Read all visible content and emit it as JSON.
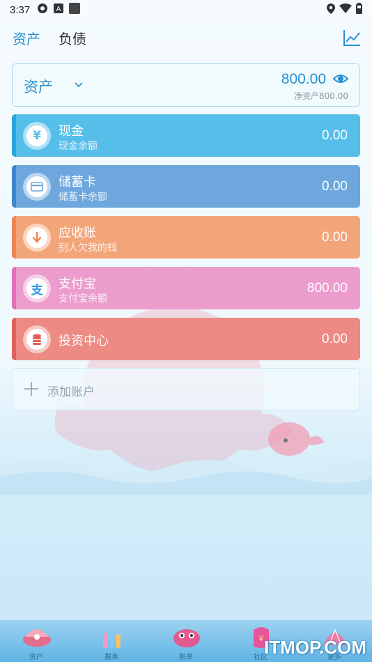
{
  "status_bar": {
    "time": "3:37",
    "icons_left": [
      "settings-icon",
      "font-icon",
      "app-icon"
    ],
    "icons_right": [
      "location-icon",
      "wifi-icon",
      "battery-icon"
    ]
  },
  "header": {
    "tabs": [
      {
        "label": "资产",
        "active": true
      },
      {
        "label": "负债",
        "active": false
      }
    ],
    "chart_icon": "trend-chart-icon"
  },
  "summary": {
    "title": "资产",
    "amount": "800.00",
    "net_assets": "净资产800.00",
    "visibility_icon": "eye-icon"
  },
  "accounts": [
    {
      "name": "现金",
      "subtitle": "现金余额",
      "balance": "0.00",
      "icon_glyph": "¥",
      "icon": "yuan-icon",
      "color": "#56bfe9",
      "strip": "#2aa3d9"
    },
    {
      "name": "储蓄卡",
      "subtitle": "储蓄卡余额",
      "balance": "0.00",
      "icon_glyph": "",
      "icon": "bank-card-icon",
      "color": "#6da7de",
      "strip": "#3f86cc"
    },
    {
      "name": "应收账",
      "subtitle": "别人欠我的钱",
      "balance": "0.00",
      "icon_glyph": "",
      "icon": "receivable-icon",
      "color": "#f3a57a",
      "strip": "#ec8650"
    },
    {
      "name": "支付宝",
      "subtitle": "支付宝余额",
      "balance": "800.00",
      "icon_glyph": "支",
      "icon": "alipay-icon",
      "color": "#ec9ccd",
      "strip": "#e070b6"
    },
    {
      "name": "投资中心",
      "subtitle": "",
      "balance": "0.00",
      "icon_glyph": "",
      "icon": "investment-coins-icon",
      "color": "#ec8a83",
      "strip": "#e0615a"
    }
  ],
  "add_account": {
    "label": "添加账户",
    "icon": "plus-icon"
  },
  "bottom_nav": [
    {
      "label": "资产",
      "icon": "shell-assets-icon"
    },
    {
      "label": "报表",
      "icon": "coral-report-icon"
    },
    {
      "label": "账单",
      "icon": "fish-bill-icon"
    },
    {
      "label": "社区",
      "icon": "community-icon"
    },
    {
      "label": "更多",
      "icon": "more-icon"
    }
  ],
  "watermark": "ITMOP.COM"
}
